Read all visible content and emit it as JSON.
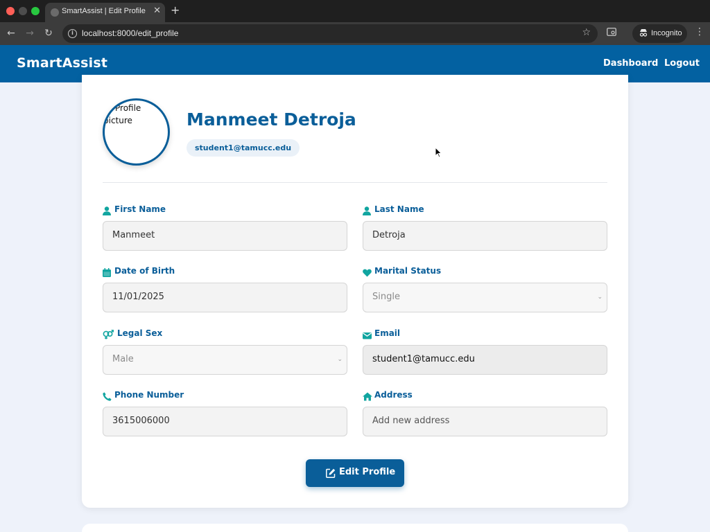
{
  "browser": {
    "tab_title": "SmartAssist | Edit Profile",
    "tab_close": "✕",
    "new_tab": "+",
    "url": "localhost:8000/edit_profile",
    "incognito_label": "Incognito"
  },
  "header": {
    "brand": "SmartAssist",
    "nav": {
      "dashboard": "Dashboard",
      "logout": "Logout"
    },
    "color": "#0361a1"
  },
  "profile": {
    "avatar_alt_text": "Profile picture",
    "name": "Manmeet Detroja",
    "email": "student1@tamucc.edu"
  },
  "form": {
    "first_name": {
      "label": "First Name",
      "value": "Manmeet",
      "icon": "user-icon"
    },
    "last_name": {
      "label": "Last Name",
      "value": "Detroja",
      "icon": "user-icon"
    },
    "dob": {
      "label": "Date of Birth",
      "value": "11/01/2025",
      "icon": "calendar-icon"
    },
    "marital_status": {
      "label": "Marital Status",
      "value": "Single",
      "icon": "heart-icon"
    },
    "legal_sex": {
      "label": "Legal Sex",
      "value": "Male",
      "icon": "gender-icon"
    },
    "email": {
      "label": "Email",
      "value": "student1@tamucc.edu",
      "icon": "envelope-icon"
    },
    "phone": {
      "label": "Phone Number",
      "value": "3615006000",
      "icon": "phone-icon"
    },
    "address": {
      "label": "Address",
      "placeholder": "Add new address",
      "icon": "home-icon"
    }
  },
  "actions": {
    "edit_profile": "Edit Profile"
  },
  "colors": {
    "accent": "#0a5e99",
    "icon_teal": "#11a5a0"
  }
}
